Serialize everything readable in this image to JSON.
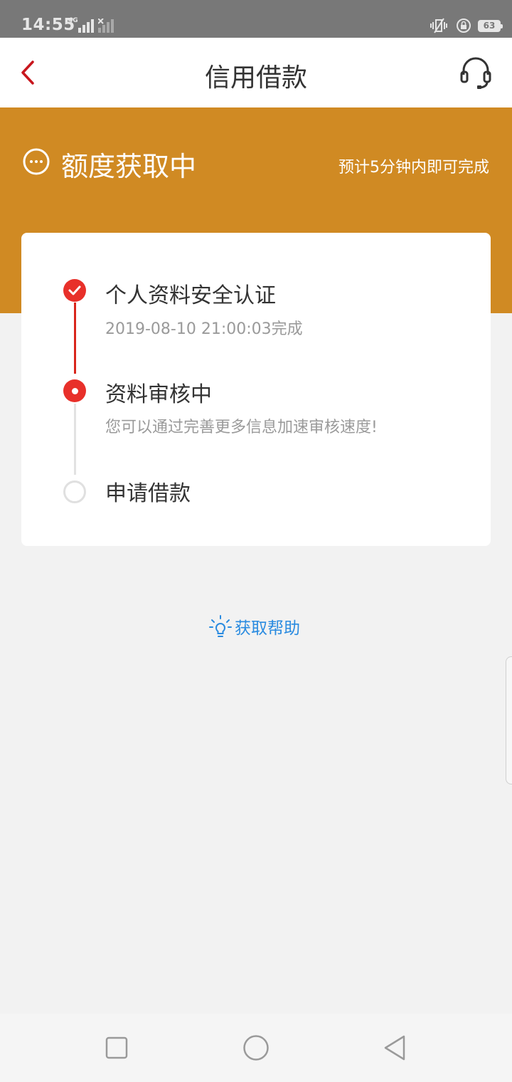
{
  "status_bar": {
    "time": "14:55",
    "network": "4G",
    "battery": "63"
  },
  "header": {
    "title": "信用借款",
    "back_icon": "chevron-left-icon",
    "service_icon": "headset-icon"
  },
  "banner": {
    "status": "额度获取中",
    "eta": "预计5分钟内即可完成",
    "status_icon": "ellipsis-circle-icon",
    "background_color": "#d08a23"
  },
  "steps": [
    {
      "title": "个人资料安全认证",
      "desc": "2019-08-10 21:00:03完成",
      "state": "done"
    },
    {
      "title": "资料审核中",
      "desc": "您可以通过完善更多信息加速审核速度!",
      "state": "active"
    },
    {
      "title": "申请借款",
      "desc": "",
      "state": "pending"
    }
  ],
  "help": {
    "label": "获取帮助",
    "icon": "lightbulb-icon"
  },
  "colors": {
    "accent_red": "#e8302a",
    "link_blue": "#2a8be0"
  }
}
